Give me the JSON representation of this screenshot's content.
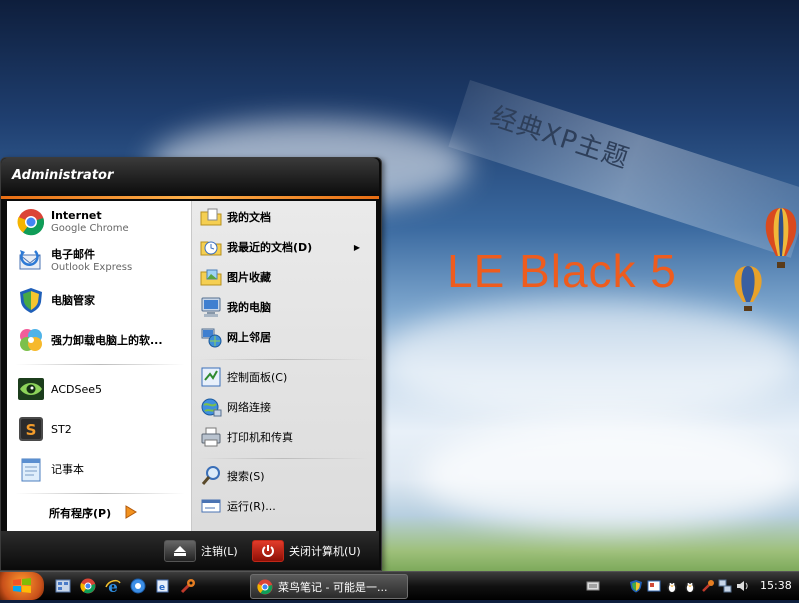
{
  "desktop": {
    "banner_text": "经典XP主题",
    "brand_text": "LE Black 5"
  },
  "start_menu": {
    "user_name": "Administrator",
    "pinned": [
      {
        "title": "Internet",
        "subtitle": "Google Chrome",
        "icon": "chrome-icon"
      },
      {
        "title": "电子邮件",
        "subtitle": "Outlook Express",
        "icon": "outlook-express-icon"
      }
    ],
    "recent": [
      {
        "title": "电脑管家",
        "icon": "pc-manager-shield-icon"
      },
      {
        "title": "强力卸载电脑上的软...",
        "icon": "uninstaller-icon"
      },
      {
        "title": "ACDSee5",
        "icon": "acdsee-eye-icon"
      },
      {
        "title": "ST2",
        "icon": "sublime-text-icon"
      },
      {
        "title": "记事本",
        "icon": "notepad-icon"
      }
    ],
    "all_programs": "所有程序(P)",
    "right_items": [
      {
        "label": "我的文档",
        "icon": "my-documents-icon"
      },
      {
        "label": "我最近的文档(D)",
        "icon": "recent-documents-icon",
        "has_submenu": true
      },
      {
        "label": "图片收藏",
        "icon": "my-pictures-icon"
      },
      {
        "label": "我的电脑",
        "icon": "my-computer-icon"
      },
      {
        "label": "网上邻居",
        "icon": "network-places-icon"
      },
      {
        "label": "控制面板(C)",
        "icon": "control-panel-icon"
      },
      {
        "label": "网络连接",
        "icon": "network-connections-icon"
      },
      {
        "label": "打印机和传真",
        "icon": "printers-faxes-icon"
      },
      {
        "label": "搜索(S)",
        "icon": "search-icon"
      },
      {
        "label": "运行(R)...",
        "icon": "run-icon"
      }
    ],
    "logoff": "注销(L)",
    "shutdown": "关闭计算机(U)"
  },
  "taskbar": {
    "task_label": "菜鸟笔记 - 可能是一...",
    "clock": "15:38"
  }
}
